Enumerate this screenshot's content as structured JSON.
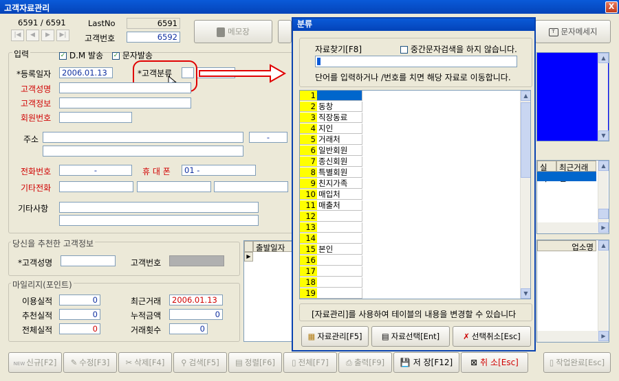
{
  "window": {
    "title": "고객자료관리",
    "close": "X"
  },
  "record": {
    "counter": "6591 / 6591",
    "lastno_label": "LastNo",
    "lastno_value": "6591",
    "custno_label": "고객번호",
    "custno_value": "6592"
  },
  "nav": {
    "first": "|◀",
    "prev": "◀",
    "next": "▶",
    "last": "▶|"
  },
  "top_buttons": {
    "memo": "메모장",
    "sms_msg": "문자메세지"
  },
  "input_section": {
    "legend": "입력",
    "dm_label": "D.M 발송",
    "sms_label": "문자발송",
    "checkmark": "✓",
    "reg_date_label": "*등록일자",
    "reg_date_value": "2006.01.13",
    "category_label": "*고객분류",
    "name_label": "고객성명",
    "info_label": "고객정보",
    "member_label": "회원번호",
    "addr_label": "주소",
    "zip_value": "-",
    "phone_label": "전화번호",
    "phone_value": "-",
    "mobile_label": "휴 대 폰",
    "mobile_value": "01  -",
    "other_phone_label": "기타전화",
    "notes_label": "기타사항"
  },
  "referrer": {
    "legend": "당신을 추천한 고객정보",
    "name_label": "*고객성명",
    "custno_label": "고객번호"
  },
  "mileage": {
    "legend": "마일리지(포인트)",
    "use_label": "이용실적",
    "use_value": "0",
    "recommend_label": "추천실적",
    "recommend_value": "0",
    "total_label": "전체실적",
    "total_value": "0",
    "recent_label": "최근거래",
    "recent_value": "2006.01.13",
    "sum_label": "누적금액",
    "sum_value": "0",
    "count_label": "거래횟수",
    "count_value": "0"
  },
  "right_grid1": {
    "col1": "실적",
    "col2": "최근거래일"
  },
  "right_grid2": {
    "col1": "업소명"
  },
  "bottom_grid": {
    "col1": "출발일자",
    "pointer": "▶"
  },
  "toolbar": {
    "new": "신규[F2]",
    "new_tag": "NEW",
    "edit": "수정[F3]",
    "delete": "삭제[F4]",
    "search": "검색[F5]",
    "sort": "정렬[F6]",
    "all": "전체[F7]",
    "print": "출력[F9]",
    "save": "저 장[F12]",
    "cancel": "취 소[Esc]",
    "done": "작업완료[Esc]"
  },
  "dialog": {
    "title": "분류",
    "search_label": "자료찾기[F8]",
    "mid_search_label": "중간문자검색을 하지 않습니다.",
    "hint": "단어를 입력하거나  /번호를 치면 해당 자료로 이동합니다.",
    "footer_note": "[자료관리]를 사용하여 테이블의 내용을 변경할 수 있습니다",
    "btn_manage": "자료관리[F5]",
    "btn_select": "자료선택[Ent]",
    "btn_cancel": "선택취소[Esc]",
    "rows": [
      {
        "n": "1",
        "v": ""
      },
      {
        "n": "2",
        "v": "동창"
      },
      {
        "n": "3",
        "v": "직장동료"
      },
      {
        "n": "4",
        "v": "지인"
      },
      {
        "n": "5",
        "v": "거래처"
      },
      {
        "n": "6",
        "v": "일반회원"
      },
      {
        "n": "7",
        "v": "종신회원"
      },
      {
        "n": "8",
        "v": "특별회원"
      },
      {
        "n": "9",
        "v": "친지가족"
      },
      {
        "n": "10",
        "v": "매입처"
      },
      {
        "n": "11",
        "v": "매출처"
      },
      {
        "n": "12",
        "v": ""
      },
      {
        "n": "13",
        "v": ""
      },
      {
        "n": "14",
        "v": ""
      },
      {
        "n": "15",
        "v": "본인"
      },
      {
        "n": "16",
        "v": ""
      },
      {
        "n": "17",
        "v": ""
      },
      {
        "n": "18",
        "v": ""
      },
      {
        "n": "19",
        "v": ""
      }
    ]
  },
  "colors": {
    "titlebar": "#0443b8",
    "accent_red": "#d00000",
    "value_blue": "#1030a0",
    "highlight_yellow": "#ffff00",
    "selected_blue": "#0066cc"
  }
}
